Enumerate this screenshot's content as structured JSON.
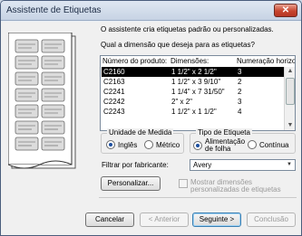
{
  "window": {
    "title": "Assistente de Etiquetas",
    "close_label": "✕"
  },
  "intro": "O assistente cria etiquetas padrão ou personalizadas.",
  "question": "Qual a dimensão que deseja para as etiquetas?",
  "product_list": {
    "headers": [
      "Número do produto:",
      "Dimensões:",
      "Numeração horizo..."
    ],
    "rows": [
      {
        "product": "C2160",
        "size": "1 1/2\" x 2 1/2\"",
        "across": "3",
        "selected": true
      },
      {
        "product": "C2163",
        "size": "1 1/2\" x 3 9/10\"",
        "across": "2",
        "selected": false
      },
      {
        "product": "C2241",
        "size": "1 1/4\" x 7 31/50\"",
        "across": "2",
        "selected": false
      },
      {
        "product": "C2242",
        "size": "2\" x 2\"",
        "across": "3",
        "selected": false
      },
      {
        "product": "C2243",
        "size": "1 1/2\" x 1 1/2\"",
        "across": "4",
        "selected": false
      }
    ]
  },
  "unit_group": {
    "title": "Unidade de Medida",
    "options": [
      {
        "label": "Inglês",
        "checked": true
      },
      {
        "label": "Métrico",
        "checked": false
      }
    ]
  },
  "label_type_group": {
    "title": "Tipo de Etiqueta",
    "options": [
      {
        "label_line1": "Alimentação",
        "label_line2": "de folha",
        "checked": true
      },
      {
        "label": "Contínua",
        "checked": false
      }
    ]
  },
  "filter": {
    "label": "Filtrar por fabricante:",
    "value": "Avery"
  },
  "customize_button": "Personalizar...",
  "custom_sizes_checkbox": {
    "line1": "Mostrar dimensões",
    "line2": "personalizadas de etiquetas",
    "checked": false
  },
  "buttons": {
    "cancel": "Cancelar",
    "back": "< Anterior",
    "next": "Seguinte >",
    "finish": "Conclusão"
  },
  "colors": {
    "selection": "#000000",
    "accent": "#1c4fa0"
  }
}
